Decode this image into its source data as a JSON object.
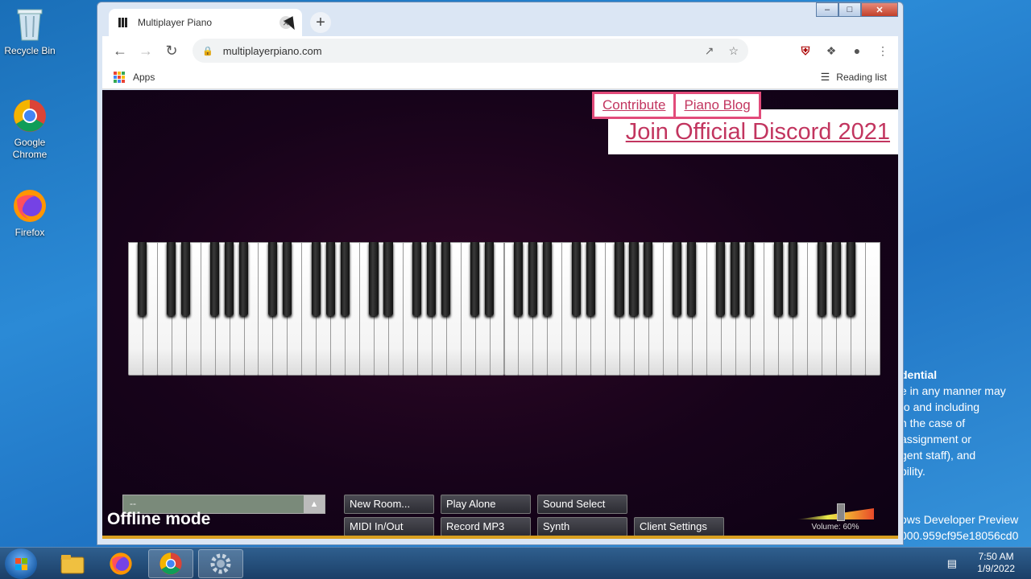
{
  "desktop": {
    "icons": [
      {
        "label": "Recycle Bin"
      },
      {
        "label": "Google Chrome"
      },
      {
        "label": "Firefox"
      }
    ],
    "notice_lines": [
      "dential",
      "e in any manner may",
      " to and including",
      "n the case of",
      " assignment or",
      "gent staff), and",
      "bility."
    ],
    "watermark_lines": [
      "ows Developer Preview",
      "000.959cf95e18056cd0"
    ]
  },
  "browser": {
    "tab_title": "Multiplayer Piano",
    "url": "multiplayerpiano.com",
    "bookmarks": {
      "apps_label": "Apps",
      "reading_list": "Reading list"
    }
  },
  "page": {
    "links": {
      "contribute": "Contribute",
      "blog": "Piano Blog",
      "discord": "Join Official Discord 2021"
    },
    "offline_text": "Offline mode",
    "room_select_value": "--",
    "buttons": {
      "new_room": "New Room...",
      "play_alone": "Play Alone",
      "sound_select": "Sound Select",
      "midi": "MIDI In/Out",
      "record": "Record MP3",
      "synth": "Synth",
      "client_settings": "Client Settings"
    },
    "volume_label": "Volume: 60%",
    "volume_level": 0.6,
    "piano_white_keys": 52
  },
  "taskbar": {
    "time": "7:50 AM",
    "date": "1/9/2022"
  },
  "colors": {
    "accent_pink": "#e24b7a",
    "link_pink": "#c2355f",
    "page_bg": "#17031a"
  }
}
